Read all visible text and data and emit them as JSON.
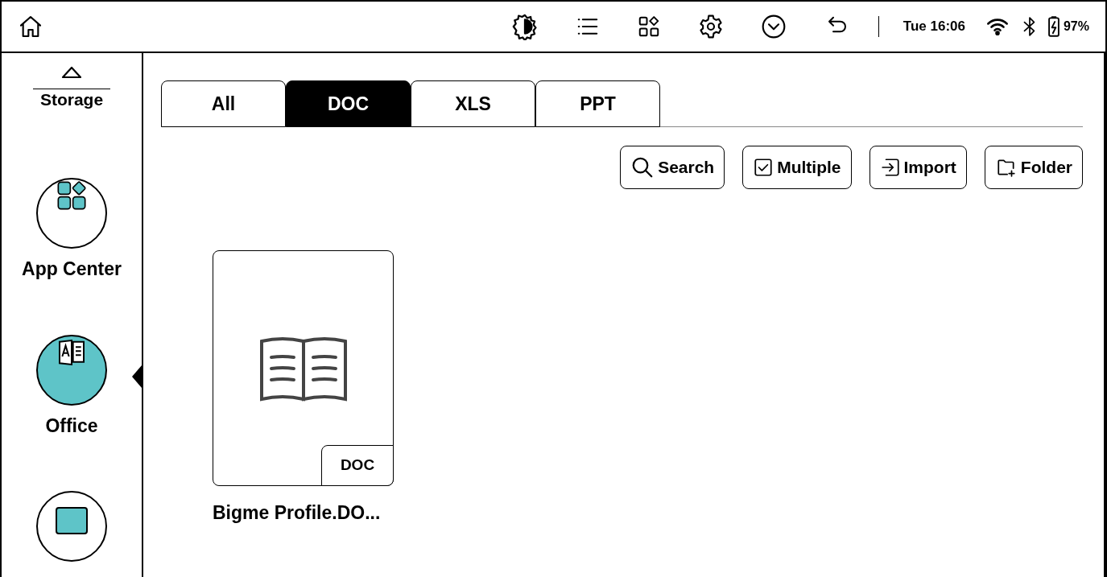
{
  "status_bar": {
    "time": "Tue 16:06",
    "battery": "97%"
  },
  "sidebar": {
    "items": [
      {
        "kind": "text",
        "label": "Storage",
        "selected": false
      },
      {
        "kind": "apps",
        "label": "App Center",
        "selected": false
      },
      {
        "kind": "office",
        "label": "Office",
        "selected": true
      },
      {
        "kind": "partial",
        "selected": false
      }
    ]
  },
  "tabs": [
    {
      "label": "All",
      "selected": false
    },
    {
      "label": "DOC",
      "selected": true
    },
    {
      "label": "XLS",
      "selected": false
    },
    {
      "label": "PPT",
      "selected": false
    }
  ],
  "actions": [
    {
      "kind": "search",
      "label": "Search"
    },
    {
      "kind": "multiple",
      "label": "Multiple"
    },
    {
      "kind": "import",
      "label": "Import"
    },
    {
      "kind": "folder",
      "label": "Folder"
    }
  ],
  "files": [
    {
      "name": "Bigme Profile.DO...",
      "type": "DOC"
    }
  ]
}
